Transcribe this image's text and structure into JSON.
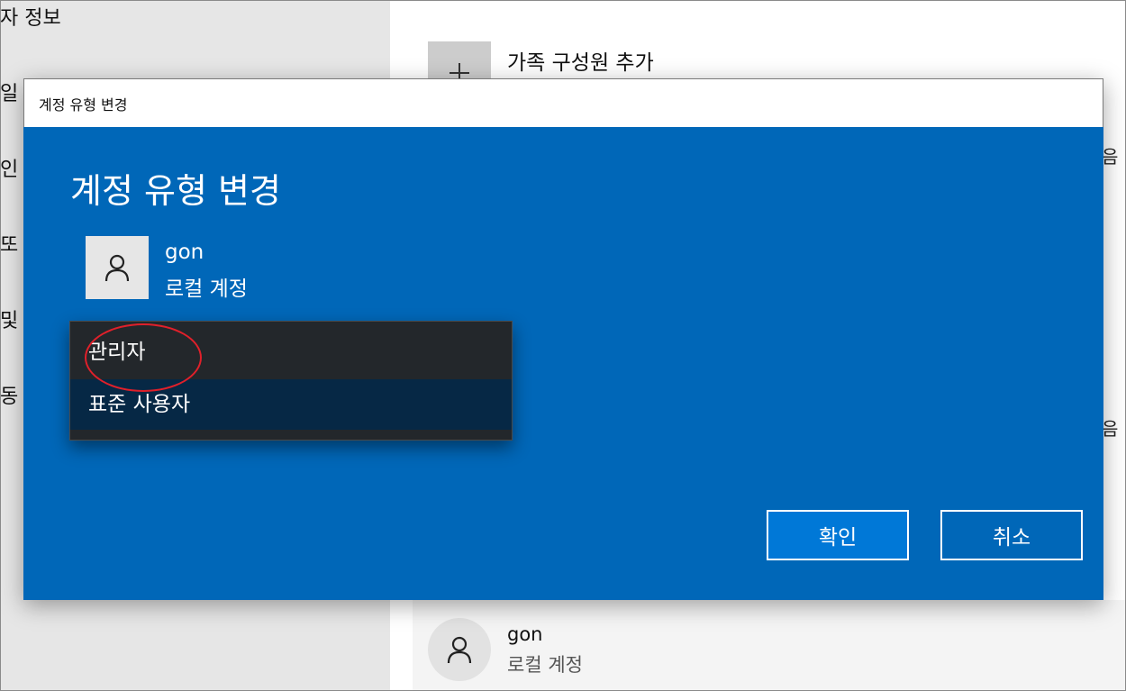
{
  "background": {
    "sidebar": {
      "items": [
        "자 정보",
        "일",
        "인",
        "또",
        "및",
        "동"
      ]
    },
    "add_family_label": "가족 구성원 추가",
    "right_clipped": [
      "음",
      "음"
    ],
    "user": {
      "name": "gon",
      "type": "로컬 계정"
    }
  },
  "dialog": {
    "window_title": "계정 유형 변경",
    "heading": "계정 유형 변경",
    "user": {
      "name": "gon",
      "type": "로컬 계정"
    },
    "account_type_options": [
      "관리자",
      "표준 사용자"
    ],
    "selected_option": "표준 사용자",
    "highlighted_option": "관리자",
    "ok_label": "확인",
    "cancel_label": "취소"
  },
  "colors": {
    "dialog_accent": "#0067b8",
    "ok_button": "#0078d7",
    "dropdown_bg": "#23272b",
    "selected_option_bg": "#062845",
    "annotation_circle": "#e0202a"
  },
  "icons": {
    "avatar": "person-icon",
    "add": "plus-icon"
  }
}
